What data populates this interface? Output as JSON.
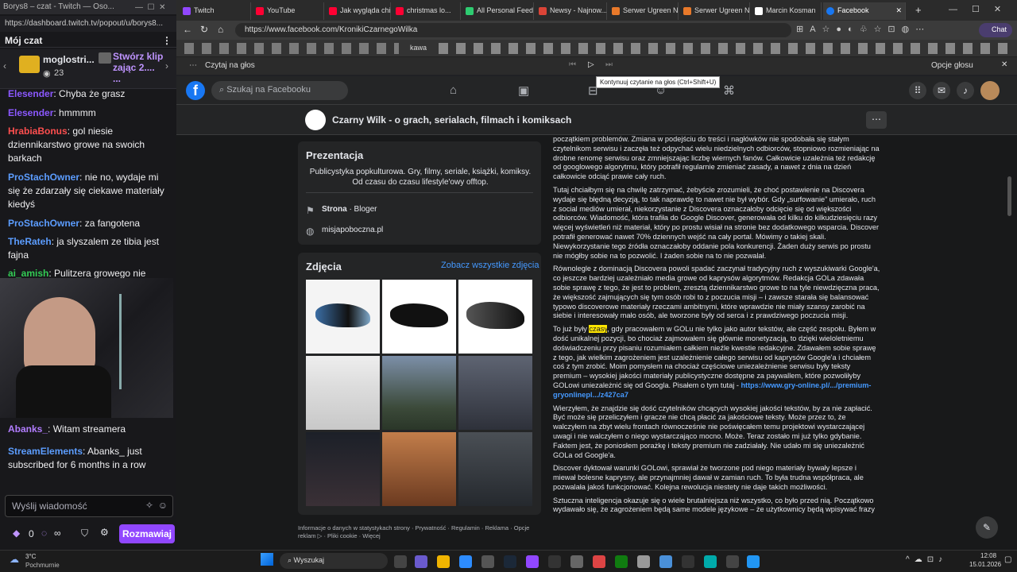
{
  "twitch": {
    "window_title": "Borys8 – czat - Twitch — Oso...",
    "url": "https://dashboard.twitch.tv/popout/u/borys8...",
    "header": "Mój czat",
    "pinned_user": "moglostri...",
    "pinned_count": "23",
    "pinned_text1": "Stwórz klip",
    "pinned_text2": "zając 2....",
    "pinned_text3": "...",
    "messages": [
      {
        "user": "Elesender",
        "text": ": Chyba że grasz",
        "color": "#8b58ff"
      },
      {
        "user": "Elesender",
        "text": ": hmmmm",
        "color": "#8b58ff"
      },
      {
        "user": "HrabiaBonus",
        "text": ": gol niesie dziennikarstwo growe na swoich barkach",
        "color": "#ff4f4f"
      },
      {
        "user": "ProStachOwner",
        "text": ": nie no, wydaje mi się że zdarzały się ciekawe materiały kiedyś",
        "color": "#5c9dff"
      },
      {
        "user": "ProStachOwner",
        "text": ": za fangotena",
        "color": "#5c9dff"
      },
      {
        "user": "TheRateh",
        "text": ": ja slyszalem ze tibia jest fajna",
        "color": "#5c9dff"
      },
      {
        "user": "ai_amish",
        "text": ": Pulitzera growego nie",
        "color": "#33cc55"
      }
    ],
    "after_video": [
      {
        "user": "Abanks_",
        "text": ": Witam streamera",
        "color": "#b27dff"
      },
      {
        "user": "StreamElements",
        "text": ": Abanks_ just subscribed for 6 months in a row",
        "color": "#5c9dff"
      }
    ],
    "input_placeholder": "Wyślij wiadomość",
    "points": "0",
    "infinity": "∞",
    "chat_button": "Rozmawiaj"
  },
  "browser": {
    "tabs": [
      {
        "label": "Twitch",
        "color": "#9147ff"
      },
      {
        "label": "YouTube",
        "color": "#ff0033"
      },
      {
        "label": "Jak wygląda chi...",
        "color": "#ff0033"
      },
      {
        "label": "christmas lo...",
        "color": "#ff0033"
      },
      {
        "label": "All Personal Feed",
        "color": "#2ecc71"
      },
      {
        "label": "Newsy - Najnow...",
        "color": "#db4437"
      },
      {
        "label": "Serwer Ugreen N...",
        "color": "#e8792a"
      },
      {
        "label": "Serwer Ugreen N...",
        "color": "#e8792a"
      },
      {
        "label": "Marcin Kosman",
        "color": "#ffffff"
      },
      {
        "label": "Facebook",
        "color": "#1877f2"
      }
    ],
    "url": "https://www.facebook.com/KronikiCzarnegoWilka",
    "read_aloud": "Czytaj na głos",
    "voice_options": "Opcje głosu",
    "tooltip": "Kontynuuj czytanie na głos (Ctrl+Shift+U)",
    "bookmark_label": "kawa"
  },
  "facebook": {
    "search_placeholder": "Szukaj na Facebooku",
    "page_name": "Czarny Wilk - o grach, serialach, filmach i komiksach",
    "intro_title": "Prezentacja",
    "intro_text": "Publicystyka popkulturowa. Gry, filmy, seriale, książki, komiksy. Od czasu do czasu lifestyle'owy offtop.",
    "category_bold": "Strona",
    "category_rest": " · Bloger",
    "website": "misjapoboczna.pl",
    "photos_title": "Zdjęcia",
    "photos_link": "Zobacz wszystkie zdjęcia",
    "footer": "Informacje o danych w statystykach strony · Prywatność · Regulamin · Reklama · Opcje reklam ▷ · Pliki cookie · Więcej",
    "post": {
      "p1": "początkiem problemów. Zmiana w podejściu do treści i nagłówków nie spodobała się stałym czytelnikom serwisu i zaczęła też odpychać wielu niedzielnych odbiorców, stopniowo rozmieniając na drobne renomę serwisu oraz zmniejszając liczbę wiernych fanów. Całkowicie uzależnia też redakcję od googlowego algorytmu, który potrafił regularnie zmieniać zasady, a nawet z dnia na dzień całkowicie odciąć prawie cały ruch.",
      "p2": "Tutaj chciałbym się na chwilę zatrzymać, żebyście zrozumieli, że choć postawienie na Discovera wydaje się błędną decyzją, to tak naprawdę to nawet nie był wybór. Gdy „surfowanie” umierało, ruch z social mediów umierał, niekorzystanie z Discovera oznaczałoby odcięcie się od większości odbiorców. Wiadomość, która trafiła do Google Discover, generowała od kilku do kilkudziesięciu razy więcej wyświetleń niż materiał, który po prostu wisiał na stronie bez dodatkowego wsparcia. Discover potrafił generować nawet 70% dziennych wejść na cały portal. Mówimy o takiej skali. Niewykorzystanie tego źródła oznaczałoby oddanie pola konkurencji. Żaden duży serwis po prostu nie mógłby sobie na to pozwolić. I żaden sobie na to nie pozwalał.",
      "p3": "Równolegle z dominacją Discovera powoli spadać zaczynał tradycyjny ruch z wyszukiwarki Google'a, co jeszcze bardziej uzależniało media growe od kaprysów algorytmów. Redakcja GOLa zdawała sobie sprawę z tego, że jest to problem, zresztą dziennikarstwo growe to na tyle niewdzięczna praca, że większość zajmujących się tym osób robi to z poczucia misji – i zawsze starała się balansować typowo discoverowe materiały rzeczami ambitnymi, które wprawdzie nie miały szansy zarobić na siebie i interesowały mało osób, ale tworzone były od serca i z prawdziwego poczucia misji.",
      "p4a": "To już były ",
      "p4hl": "czasy",
      "p4b": ", gdy pracowałem w GOLu nie tylko jako autor tekstów, ale część zespołu. Byłem w dość unikalnej pozycji, bo chociaż zajmowałem się głównie monetyzacją, to dzięki wieloletniemu doświadczeniu przy pisaniu rozumiałem całkiem nieźle kwestie redakcyjne. Zdawałem sobie sprawę z tego, jak wielkim zagrożeniem jest uzależnienie całego serwisu od kaprysów Google'a i chciałem coś z tym zrobić. Moim pomysłem na chociaż częściowe uniezależnienie serwisu były teksty premium – wysokiej jakości materiały publicystyczne dostępne za paywallem, które pozwoliłyby GOLowi uniezależnić się od Googla. Pisałem o tym tutaj - ",
      "p4link": "https://www.gry-online.pl/.../premium-gryonlinepl.../z427ca7",
      "p5": "Wierzyłem, że znajdzie się dość czytelników chcących wysokiej jakości tekstów, by za nie zapłacić. Być może się przeliczyłem i gracze nie chcą płacić za jakościowe teksty. Może przez to, że walczyłem na zbyt wielu frontach równocześnie nie poświęcałem temu projektowi wystarczającej uwagi i nie walczyłem o niego wystarczająco mocno. Może. Teraz zostało mi już tylko gdybanie. Faktem jest, że poniosłem porażkę i teksty premium nie zadziałały. Nie udało mi się uniezależnić GOLa od Google'a.",
      "p6": "Discover dyktował warunki GOLowi, sprawiał że tworzone pod niego materiały bywały lepsze i miewał bolesne kaprysny, ale przynajmniej dawał w zamian ruch. To była trudna współpraca, ale pozwalała jakoś funkcjonować. Kolejna rewolucja niestety nie daje takich możliwości.",
      "p7": "Sztuczna inteligencja okazuje się o wiele brutalniejsza niż wszystko, co było przed nią. Początkowo wydawało się, że zagrożeniem będą same modele językowe – że użytkownicy będą wpisywać frazy"
    }
  },
  "taskbar": {
    "weather_temp": "3°C",
    "weather_desc": "Pochmurnie",
    "search": "Wyszukaj",
    "time": "12:08",
    "date": "15.01.2026"
  }
}
